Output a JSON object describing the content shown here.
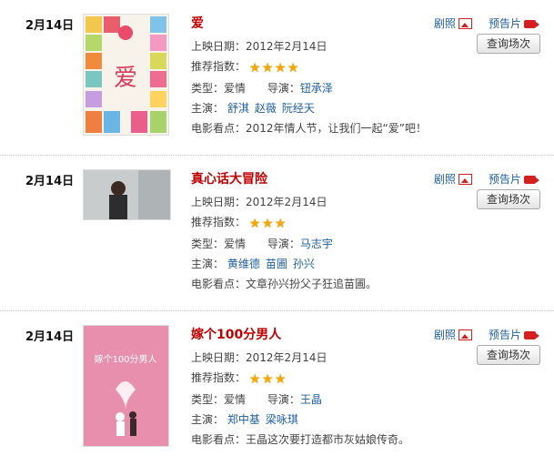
{
  "actions": {
    "stills": "剧照",
    "trailer": "预告片",
    "schedule_button": "查询场次"
  },
  "labels": {
    "release": "上映日期：",
    "rating": "推荐指数：",
    "genre": "类型：",
    "director": "导演：",
    "cast": "主演：",
    "highlight": "电影看点："
  },
  "movies": [
    {
      "date": "2月14日",
      "title": "爱",
      "release": "2012年2月14日",
      "rating": 4,
      "genre": "爱情",
      "director": "钮承泽",
      "cast": [
        "舒淇",
        "赵薇",
        "阮经天"
      ],
      "highlight": "2012年情人节，让我们一起“爱”吧！",
      "poster_text": "爱"
    },
    {
      "date": "2月14日",
      "title": "真心话大冒险",
      "release": "2012年2月14日",
      "rating": 3,
      "genre": "爱情",
      "director": "马志宇",
      "cast": [
        "黄维德",
        "苗圃",
        "孙兴"
      ],
      "highlight": "文章孙兴扮父子狂追苗圃。"
    },
    {
      "date": "2月14日",
      "title": "嫁个100分男人",
      "release": "2012年2月14日",
      "rating": 3,
      "genre": "爱情",
      "director": "王晶",
      "cast": [
        "郑中基",
        "梁咏琪"
      ],
      "highlight": "王晶这次要打造都市灰姑娘传奇。",
      "poster_text": "嫁个100分男人"
    }
  ],
  "colors": {
    "title": "#c10000",
    "link": "#1f5f9f",
    "star": "#f4a800",
    "icon": "#d42020",
    "poster3_bg": "#e98fae"
  }
}
